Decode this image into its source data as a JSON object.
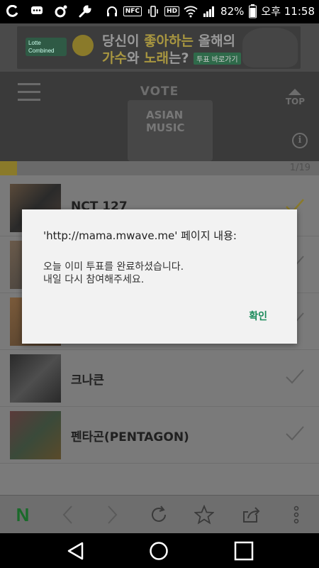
{
  "status_bar": {
    "battery": "82%",
    "time": "오후 11:58",
    "icons": [
      "o-app-icon",
      "chat-icon",
      "circle-app-icon",
      "wrench-icon",
      "headset-icon",
      "nfc-icon",
      "vibrate-icon",
      "hd-icon",
      "wifi-icon",
      "signal-icon",
      "battery-icon"
    ],
    "nfc_label": "NFC",
    "hd_label": "HD"
  },
  "ad": {
    "line1_pre": "당신이 ",
    "line1_hl": "좋아하는",
    "line1_post": " 올해의",
    "line2_pre": "가수",
    "line2_mid": "와 ",
    "line2_hl": "노래",
    "line2_post": "는? ",
    "button": "투표 바로가기",
    "logo_text": "Lotte Combined"
  },
  "header": {
    "title": "VOTE",
    "top_label": "TOP",
    "event_logo": "ASIAN MUSIC",
    "info_glyph": "i"
  },
  "progress": {
    "text": "1/19",
    "fraction": 0.0526
  },
  "candidates": [
    {
      "name": "NCT 127"
    },
    {
      "name": ""
    },
    {
      "name": ""
    },
    {
      "name": "크나큰"
    },
    {
      "name": "펜타곤(PENTAGON)"
    }
  ],
  "dialog": {
    "title": "'http://mama.mwave.me' 페이지 내용:",
    "message_line1": "오늘 이미 투표를 완료하셨습니다.",
    "message_line2": "내일 다시 참여해주세요.",
    "ok_label": "확인"
  },
  "toolbar": {
    "n_label": "N"
  },
  "colors": {
    "dialog_button": "#1a8a5a",
    "page_dim": "#7a7a7a",
    "naver_green": "#1a6a2a"
  }
}
